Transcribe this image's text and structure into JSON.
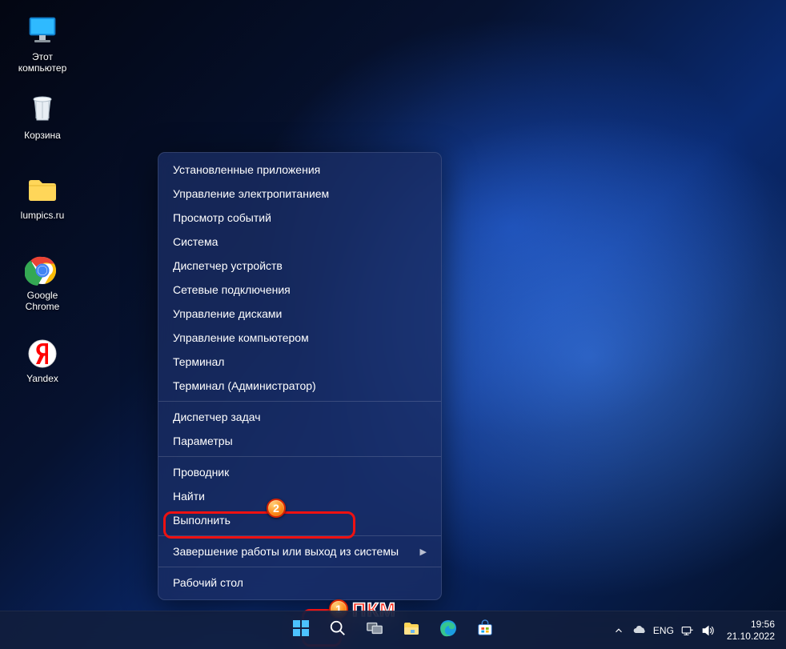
{
  "desktop": {
    "icons": [
      {
        "label": "Этот компьютер"
      },
      {
        "label": "Корзина"
      },
      {
        "label": "lumpics.ru"
      },
      {
        "label": "Google Chrome"
      },
      {
        "label": "Yandex"
      }
    ]
  },
  "context_menu": {
    "groups": [
      {
        "items": [
          {
            "label": "Установленные приложения",
            "submenu": false
          },
          {
            "label": "Управление электропитанием",
            "submenu": false
          },
          {
            "label": "Просмотр событий",
            "submenu": false
          },
          {
            "label": "Система",
            "submenu": false
          },
          {
            "label": "Диспетчер устройств",
            "submenu": false
          },
          {
            "label": "Сетевые подключения",
            "submenu": false
          },
          {
            "label": "Управление дисками",
            "submenu": false
          },
          {
            "label": "Управление компьютером",
            "submenu": false
          },
          {
            "label": "Терминал",
            "submenu": false
          },
          {
            "label": "Терминал (Администратор)",
            "submenu": false
          }
        ]
      },
      {
        "items": [
          {
            "label": "Диспетчер задач",
            "submenu": false
          },
          {
            "label": "Параметры",
            "submenu": false
          }
        ]
      },
      {
        "items": [
          {
            "label": "Проводник",
            "submenu": false
          },
          {
            "label": "Найти",
            "submenu": false
          },
          {
            "label": "Выполнить",
            "submenu": false
          }
        ]
      },
      {
        "items": [
          {
            "label": "Завершение работы или выход из системы",
            "submenu": true
          }
        ]
      },
      {
        "items": [
          {
            "label": "Рабочий стол",
            "submenu": false
          }
        ]
      }
    ]
  },
  "annotations": {
    "badge1": "1",
    "badge2": "2",
    "pkm": "ПКМ"
  },
  "taskbar": {
    "center_icons": [
      "start-icon",
      "search-icon",
      "task-view-icon",
      "file-explorer-icon",
      "edge-icon",
      "store-icon"
    ]
  },
  "systray": {
    "language": "ENG",
    "time": "19:56",
    "date": "21.10.2022"
  }
}
